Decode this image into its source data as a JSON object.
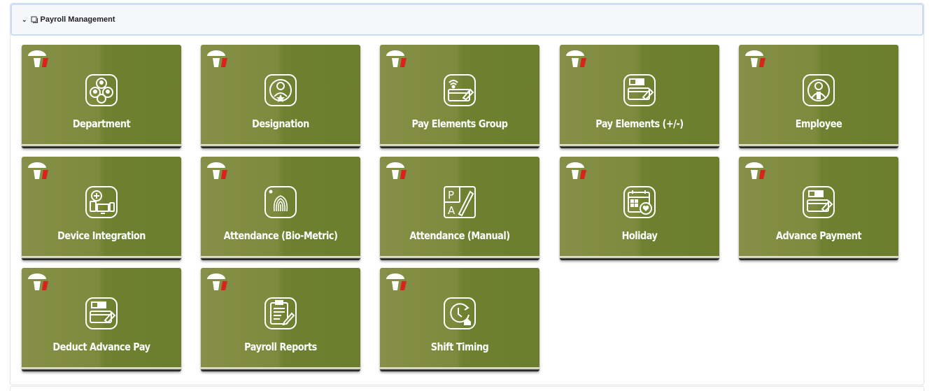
{
  "panel": {
    "title": "Payroll Management",
    "expanded": true
  },
  "tiles": [
    {
      "label": "Department",
      "icon": "department-icon"
    },
    {
      "label": "Designation",
      "icon": "designation-icon"
    },
    {
      "label": "Pay Elements Group",
      "icon": "pay-elements-group-icon"
    },
    {
      "label": "Pay Elements (+/-)",
      "icon": "pay-elements-icon"
    },
    {
      "label": "Employee",
      "icon": "employee-icon"
    },
    {
      "label": "Device Integration",
      "icon": "device-integration-icon"
    },
    {
      "label": "Attendance (Bio-Metric)",
      "icon": "fingerprint-icon"
    },
    {
      "label": "Attendance (Manual)",
      "icon": "manual-attendance-icon"
    },
    {
      "label": "Holiday",
      "icon": "holiday-calendar-icon"
    },
    {
      "label": "Advance Payment",
      "icon": "advance-payment-icon"
    },
    {
      "label": "Deduct Advance Pay",
      "icon": "deduct-advance-icon"
    },
    {
      "label": "Payroll Reports",
      "icon": "payroll-reports-icon"
    },
    {
      "label": "Shift Timing",
      "icon": "shift-timing-icon"
    }
  ],
  "colors": {
    "tile_green": "#7a8a3a",
    "header_bg": "#f5f7fa",
    "header_border": "#c9dcf3",
    "logo_red": "#d9211d"
  }
}
